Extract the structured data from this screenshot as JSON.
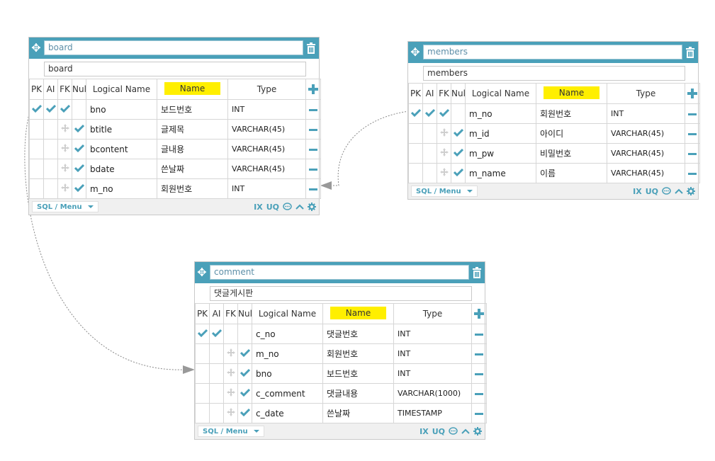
{
  "headers": {
    "pk": "PK",
    "ai": "AI",
    "fk": "FK",
    "null": "Null",
    "logical": "Logical Name",
    "name": "Name",
    "type": "Type"
  },
  "footer": {
    "sql_menu": "SQL / Menu",
    "ix": "IX",
    "uq": "UQ"
  },
  "tables": {
    "board": {
      "name": "board",
      "comment": "board",
      "columns": [
        {
          "logical": "bno",
          "name": "보드번호",
          "type": "INT",
          "pk": true,
          "ai": true,
          "fk": true,
          "nn": false
        },
        {
          "logical": "btitle",
          "name": "글제목",
          "type": "VARCHAR(45)",
          "pk": false,
          "ai": false,
          "fk": false,
          "nn": true
        },
        {
          "logical": "bcontent",
          "name": "글내용",
          "type": "VARCHAR(45)",
          "pk": false,
          "ai": false,
          "fk": false,
          "nn": true
        },
        {
          "logical": "bdate",
          "name": "쓴날짜",
          "type": "VARCHAR(45)",
          "pk": false,
          "ai": false,
          "fk": false,
          "nn": true
        },
        {
          "logical": "m_no",
          "name": "회원번호",
          "type": "INT",
          "pk": false,
          "ai": false,
          "fk": false,
          "nn": true
        }
      ]
    },
    "members": {
      "name": "members",
      "comment": "members",
      "columns": [
        {
          "logical": "m_no",
          "name": "회원번호",
          "type": "INT",
          "pk": true,
          "ai": true,
          "fk": true,
          "nn": false
        },
        {
          "logical": "m_id",
          "name": "아이디",
          "type": "VARCHAR(45)",
          "pk": false,
          "ai": false,
          "fk": false,
          "nn": true
        },
        {
          "logical": "m_pw",
          "name": "비밀번호",
          "type": "VARCHAR(45)",
          "pk": false,
          "ai": false,
          "fk": false,
          "nn": true
        },
        {
          "logical": "m_name",
          "name": "이름",
          "type": "VARCHAR(45)",
          "pk": false,
          "ai": false,
          "fk": false,
          "nn": true
        }
      ]
    },
    "comment": {
      "name": "comment",
      "comment": "댓글게시판",
      "columns": [
        {
          "logical": "c_no",
          "name": "댓글번호",
          "type": "INT",
          "pk": true,
          "ai": true,
          "fk": false,
          "nn": false
        },
        {
          "logical": "m_no",
          "name": "회원번호",
          "type": "INT",
          "pk": false,
          "ai": false,
          "fk": false,
          "nn": true
        },
        {
          "logical": "bno",
          "name": "보드번호",
          "type": "INT",
          "pk": false,
          "ai": false,
          "fk": false,
          "nn": true
        },
        {
          "logical": "c_comment",
          "name": "댓글내용",
          "type": "VARCHAR(1000)",
          "pk": false,
          "ai": false,
          "fk": false,
          "nn": true
        },
        {
          "logical": "c_date",
          "name": "쓴날짜",
          "type": "TIMESTAMP",
          "pk": false,
          "ai": false,
          "fk": false,
          "nn": true
        }
      ]
    }
  },
  "colors": {
    "accent": "#4aa0b9",
    "highlight": "#ffef00",
    "header_bg": "#4aa0b9"
  }
}
